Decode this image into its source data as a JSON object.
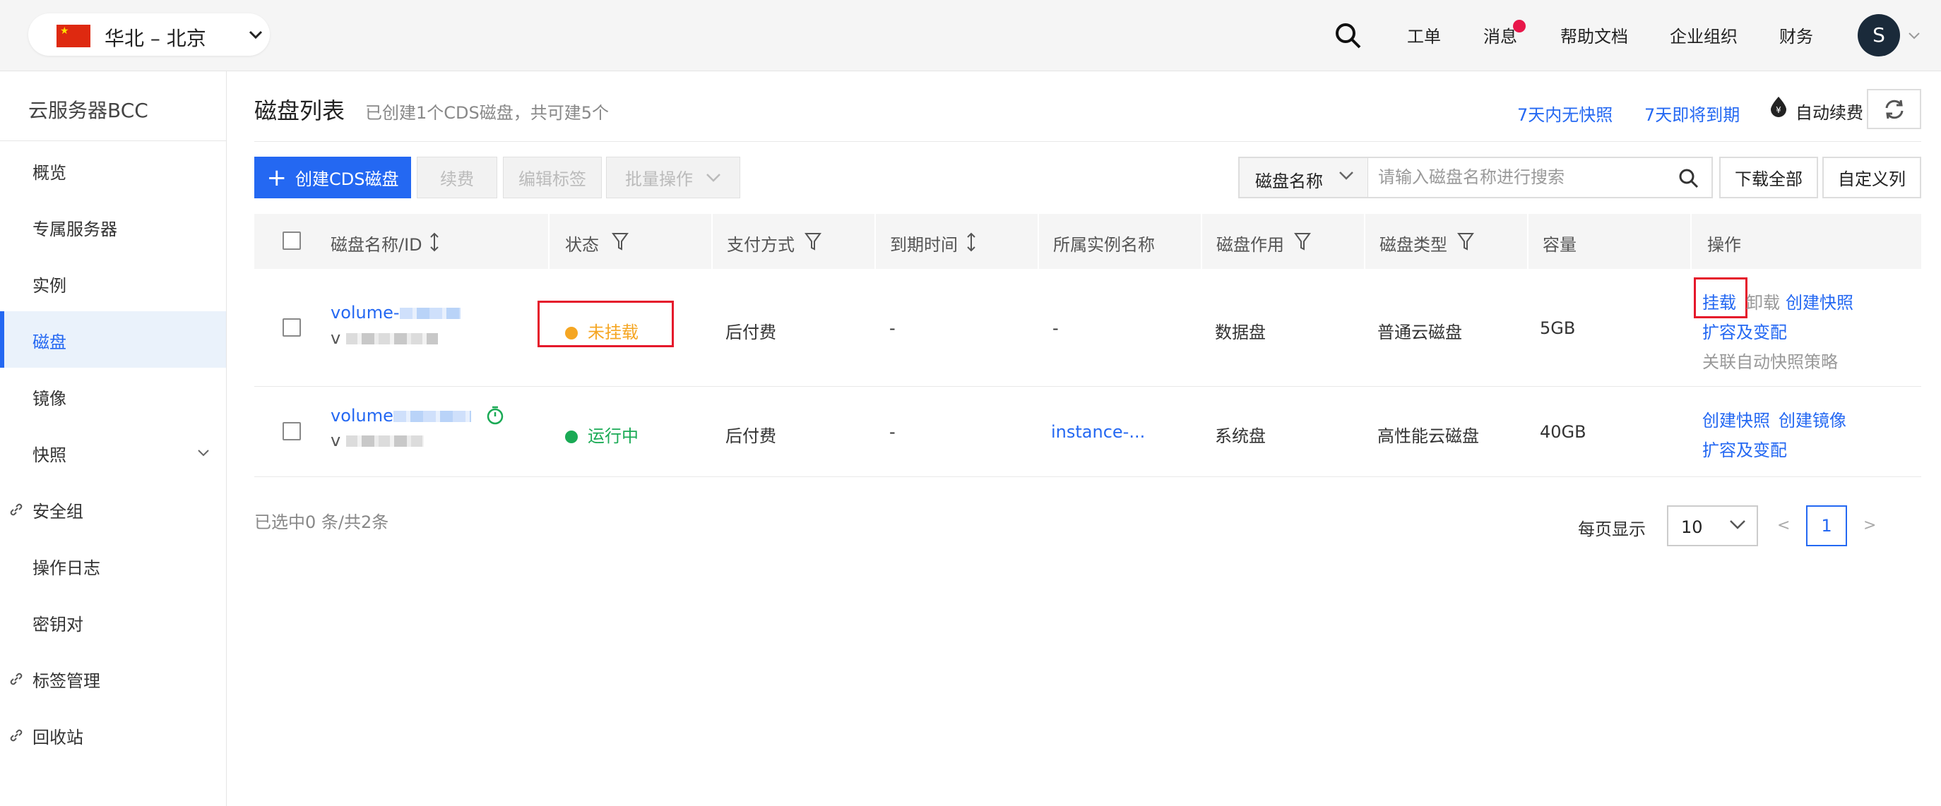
{
  "topbar": {
    "region": "华北 – 北京",
    "nav": [
      "工单",
      "消息",
      "帮助文档",
      "企业组织",
      "财务"
    ],
    "avatar": "S"
  },
  "sidebar": {
    "title": "云服务器BCC",
    "items": [
      {
        "label": "概览"
      },
      {
        "label": "专属服务器"
      },
      {
        "label": "实例"
      },
      {
        "label": "磁盘",
        "active": true
      },
      {
        "label": "镜像"
      },
      {
        "label": "快照",
        "expandable": true
      },
      {
        "label": "安全组",
        "external": true
      },
      {
        "label": "操作日志"
      },
      {
        "label": "密钥对"
      },
      {
        "label": "标签管理",
        "external": true
      },
      {
        "label": "回收站",
        "external": true
      }
    ]
  },
  "header": {
    "title": "磁盘列表",
    "subtitle": "已创建1个CDS磁盘，共可建5个",
    "links": [
      "7天内无快照",
      "7天即将到期"
    ],
    "auto_renew": "自动续费"
  },
  "toolbar": {
    "create": "创建CDS磁盘",
    "renew": "续费",
    "edit_tags": "编辑标签",
    "batch": "批量操作",
    "search_type": "磁盘名称",
    "search_placeholder": "请输入磁盘名称进行搜索",
    "download_all": "下载全部",
    "custom_columns": "自定义列"
  },
  "table": {
    "columns": [
      "磁盘名称/ID",
      "状态",
      "支付方式",
      "到期时间",
      "所属实例名称",
      "磁盘作用",
      "磁盘类型",
      "容量",
      "操作"
    ],
    "rows": [
      {
        "name_prefix": "volume-",
        "id_prefix": "v",
        "status": "未挂载",
        "status_color": "#f5a623",
        "payment": "后付费",
        "expire": "-",
        "instance": "-",
        "role": "数据盘",
        "type": "普通云磁盘",
        "capacity": "5GB",
        "actions": {
          "mount": "挂载",
          "unmount": "卸载",
          "snapshot": "创建快照",
          "resize": "扩容及变配",
          "auto_snapshot": "关联自动快照策略"
        }
      },
      {
        "name_prefix": "volume",
        "id_prefix": "v",
        "status": "运行中",
        "status_color": "#1aaa55",
        "payment": "后付费",
        "expire": "-",
        "instance": "instance-...",
        "role": "系统盘",
        "type": "高性能云磁盘",
        "capacity": "40GB",
        "actions": {
          "snapshot": "创建快照",
          "image": "创建镜像",
          "resize": "扩容及变配"
        }
      }
    ]
  },
  "footer": {
    "selection": "已选中0 条/共2条",
    "page_size_label": "每页显示",
    "page_size": "10",
    "prev": "<",
    "page": "1",
    "next": ">"
  },
  "colors": {
    "primary": "#2468f2",
    "highlight": "#e5182b"
  }
}
